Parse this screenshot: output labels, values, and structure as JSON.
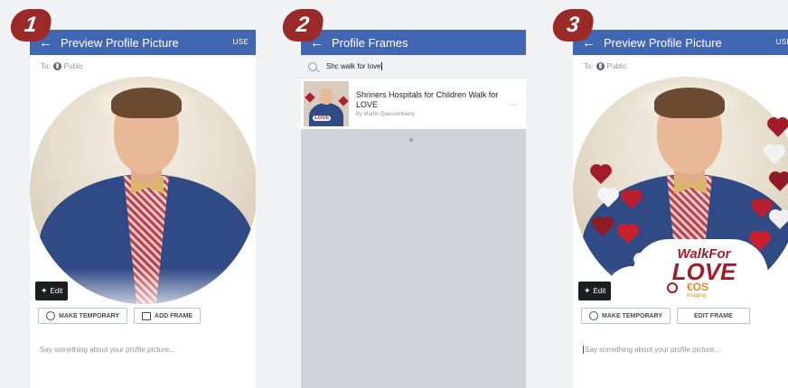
{
  "colors": {
    "header_blue": "#4267b2",
    "badge_red": "#9a2a27",
    "gray_bg": "#d0d3d8"
  },
  "steps": [
    "1",
    "2",
    "3"
  ],
  "panel1": {
    "title": "Preview Profile Picture",
    "use_label": "USE",
    "audience": "To:",
    "audience_value": "Public",
    "edit_label": "Edit",
    "make_temporary_label": "MAKE TEMPORARY",
    "add_frame_label": "ADD FRAME",
    "compose_placeholder": "Say something about your profile picture..."
  },
  "panel2": {
    "title": "Profile Frames",
    "search_value": "Shc walk for love",
    "result": {
      "title": "Shriners Hospitals for Children Walk for LOVE",
      "author": "By Martin Quessenberry",
      "thumb_label": "LOVE",
      "more_icon": "more-dots-icon"
    }
  },
  "panel3": {
    "title": "Preview Profile Picture",
    "use_label": "USE",
    "audience": "To:",
    "audience_value": "Public",
    "edit_label": "Edit",
    "make_temporary_label": "MAKE TEMPORARY",
    "edit_frame_label": "EDIT FRAME",
    "compose_placeholder": "Say something about your profile picture...",
    "frame": {
      "line1": "WalkFor",
      "line2": "LOVE",
      "sponsor_mark": "€OS",
      "sponsor_sub": "imaging"
    }
  }
}
